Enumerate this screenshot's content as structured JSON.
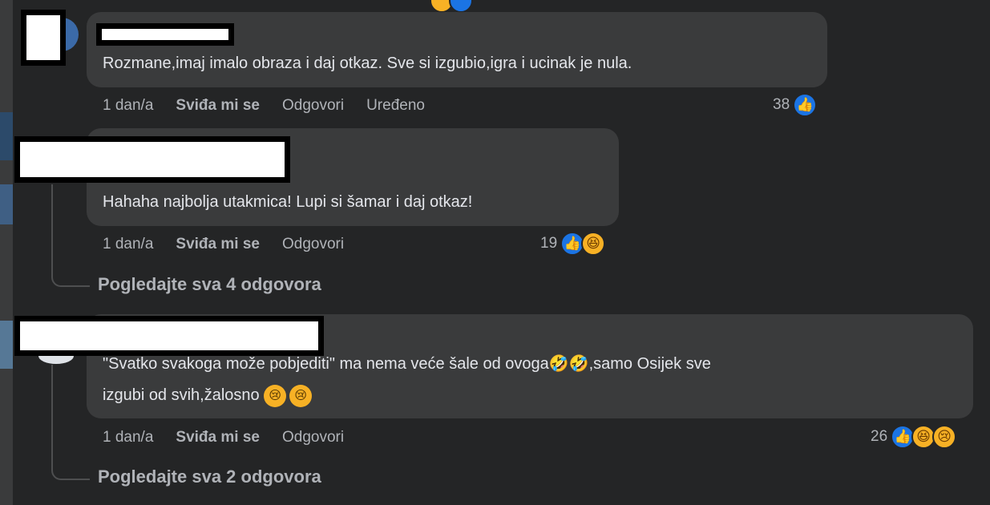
{
  "comments": [
    {
      "text": "Rozmane,imaj imalo obraza i daj otkaz. Sve si izgubio,igra i ucinak je nula.",
      "time": "1 dan/a",
      "like_label": "Sviđa mi se",
      "reply_label": "Odgovori",
      "edited_label": "Uređeno",
      "reaction_count": "38",
      "reactions": [
        "like-icon"
      ]
    },
    {
      "text": "Hahaha najbolja utakmica! Lupi si šamar i daj otkaz!",
      "time": "1 dan/a",
      "like_label": "Sviđa mi se",
      "reply_label": "Odgovori",
      "reaction_count": "19",
      "reactions": [
        "like-icon",
        "laugh-icon"
      ],
      "view_replies": "Pogledajte sva 4 odgovora"
    },
    {
      "text_line1": "\"Svatko svakoga može pobjediti\" ma nema veće šale od ovoga",
      "text_line1_emoji": "🤣🤣",
      "text_line1_end": ",samo Osijek sve",
      "text_line2": "izgubi od svih,žalosno ",
      "time": "1 dan/a",
      "like_label": "Sviđa mi se",
      "reply_label": "Odgovori",
      "reaction_count": "26",
      "reactions": [
        "like-icon",
        "laugh-icon",
        "sad-icon"
      ],
      "view_replies": "Pogledajte sva 2 odgovora"
    }
  ]
}
